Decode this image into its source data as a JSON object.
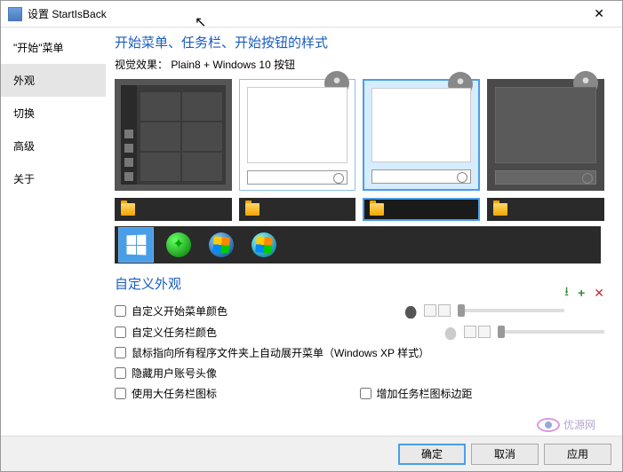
{
  "window": {
    "title": "设置 StartIsBack"
  },
  "sidebar": {
    "items": [
      {
        "label": "\"开始\"菜单"
      },
      {
        "label": "外观"
      },
      {
        "label": "切换"
      },
      {
        "label": "高级"
      },
      {
        "label": "关于"
      }
    ],
    "active_index": 1
  },
  "main": {
    "heading": "开始菜单、任务栏、开始按钮的样式",
    "visual_label": "视觉效果：",
    "visual_value": "Plain8 + Windows 10 按钮",
    "custom_heading": "自定义外观",
    "checks": {
      "c0": "自定义开始菜单颜色",
      "c1": "自定义任务栏颜色",
      "c2": "鼠标指向所有程序文件夹上自动展开菜单（Windows XP 样式）",
      "c3": "隐藏用户账号头像",
      "c4": "使用大任务栏图标",
      "c5": "增加任务栏图标边距"
    }
  },
  "footer": {
    "ok": "确定",
    "cancel": "取消",
    "apply": "应用"
  },
  "watermark": "优源网"
}
